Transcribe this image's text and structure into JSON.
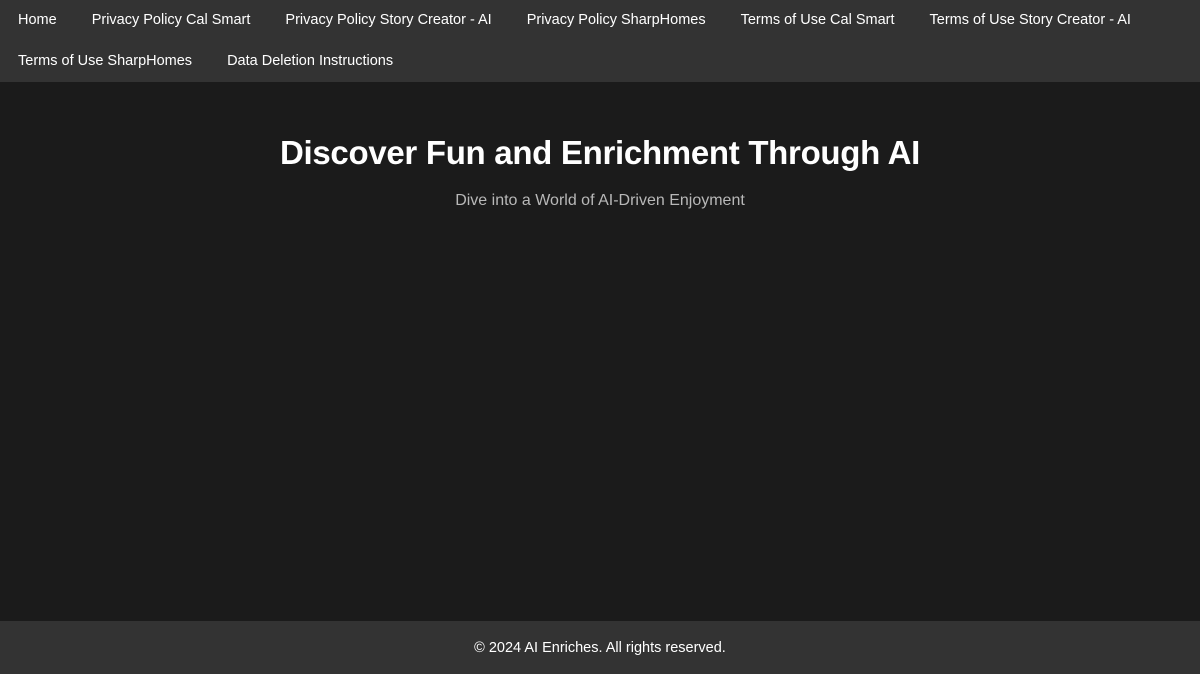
{
  "nav": {
    "row1": [
      {
        "label": "Home"
      },
      {
        "label": "Privacy Policy Cal Smart"
      },
      {
        "label": "Privacy Policy Story Creator - AI"
      },
      {
        "label": "Privacy Policy SharpHomes"
      },
      {
        "label": "Terms of Use Cal Smart"
      },
      {
        "label": "Terms of Use Story Creator - AI"
      }
    ],
    "row2": [
      {
        "label": "Terms of Use SharpHomes"
      },
      {
        "label": "Data Deletion Instructions"
      }
    ]
  },
  "hero": {
    "title": "Discover Fun and Enrichment Through AI",
    "subtitle": "Dive into a World of AI-Driven Enjoyment"
  },
  "footer": {
    "copyright": "© 2024 AI Enriches. All rights reserved."
  },
  "colors": {
    "background": "#1b1b1b",
    "bar": "#333333",
    "text": "#ffffff",
    "subtitle": "#b8b8b8"
  }
}
